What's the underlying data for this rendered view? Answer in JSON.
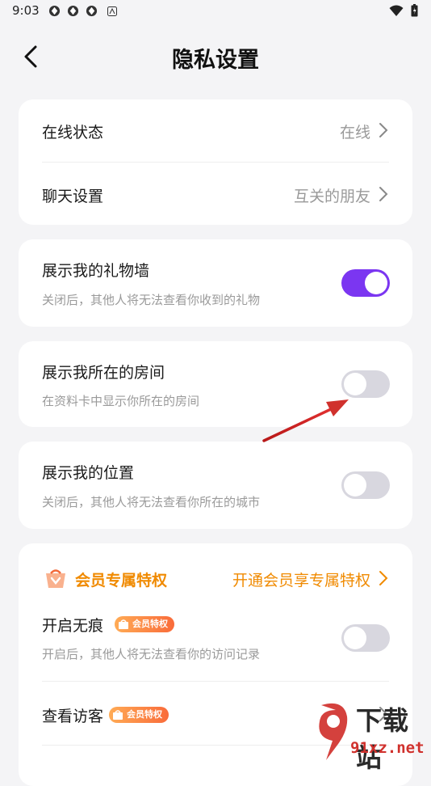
{
  "status_bar": {
    "time": "9:03",
    "notification_icons": [
      "app-icon",
      "app-icon",
      "app-icon",
      "a-icon"
    ],
    "right_icons": [
      "wifi-icon",
      "battery-icon"
    ]
  },
  "header": {
    "title": "隐私设置",
    "back_icon": "chevron-left-icon"
  },
  "basic_card": {
    "online_status": {
      "label": "在线状态",
      "value": "在线"
    },
    "chat_settings": {
      "label": "聊天设置",
      "value": "互关的朋友"
    }
  },
  "gift_wall": {
    "label": "展示我的礼物墙",
    "desc": "关闭后，其他人将无法查看你收到的礼物",
    "enabled": true
  },
  "room": {
    "label": "展示我所在的房间",
    "desc": "在资料卡中显示你所在的房间",
    "enabled": false
  },
  "location": {
    "label": "展示我的位置",
    "desc": "关闭后，其他人将无法查看你所在的城市",
    "enabled": false
  },
  "vip": {
    "title": "会员专属特权",
    "link": "开通会员享专属特权",
    "incognito": {
      "label": "开启无痕",
      "badge": "会员特权",
      "desc": "开启后，其他人将无法查看你的访问记录",
      "enabled": false
    },
    "visitors": {
      "label": "查看访客",
      "badge": "会员特权"
    }
  },
  "watermark": {
    "text": "下载站",
    "url": "91xz.net"
  },
  "colors": {
    "accent": "#7b36f1",
    "vip": "#f08a00",
    "arrow": "#d0312d"
  }
}
